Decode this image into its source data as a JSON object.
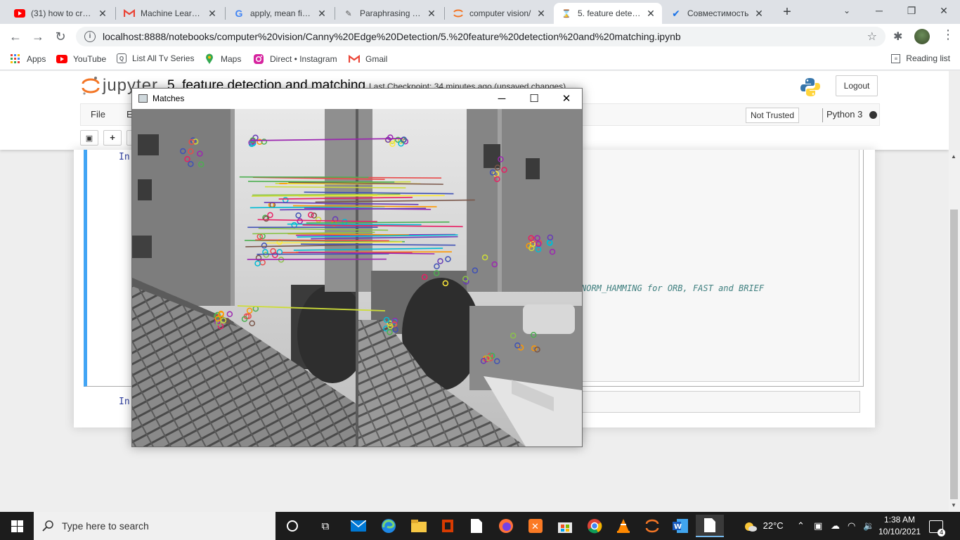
{
  "browser": {
    "tabs": [
      {
        "title": "(31) how to creat",
        "favicon": "youtube-icon",
        "color": "#ff0000"
      },
      {
        "title": "Machine Learning",
        "favicon": "gmail-icon",
        "color": "#ea4335"
      },
      {
        "title": "apply, mean filter",
        "favicon": "google-icon",
        "color": "#4285f4"
      },
      {
        "title": "Paraphrasing Too",
        "favicon": "quill-icon",
        "color": "#555555"
      },
      {
        "title": "computer vision/",
        "favicon": "jupyter-icon",
        "color": "#f37626"
      },
      {
        "title": "5. feature detectio",
        "favicon": "hourglass-icon",
        "color": "#f37626"
      },
      {
        "title": "Совместимость",
        "favicon": "checkmark-icon",
        "color": "#1a73e8"
      }
    ],
    "url": "localhost:8888/notebooks/computer%20vision/Canny%20Edge%20Detection/5.%20feature%20detection%20and%20matching.ipynb",
    "bookmarks": [
      {
        "label": "Apps",
        "icon": "apps-grid-icon"
      },
      {
        "label": "YouTube",
        "icon": "youtube-icon"
      },
      {
        "label": "List All Tv Series",
        "icon": "tv-icon"
      },
      {
        "label": "Maps",
        "icon": "maps-pin-icon"
      },
      {
        "label": "Direct • Instagram",
        "icon": "instagram-icon"
      },
      {
        "label": "Gmail",
        "icon": "gmail-icon"
      }
    ],
    "reading_list": "Reading list"
  },
  "jupyter": {
    "logo_text": "jupyter",
    "notebook_title": "5. feature detection and matching",
    "checkpoint": "Last Checkpoint: 34 minutes ago  (unsaved changes)",
    "logout": "Logout",
    "menu": [
      "File",
      "E"
    ],
    "trusted": "Not Trusted",
    "kernel": "Python 3",
    "toolbar": {
      "save": "💾",
      "add": "+"
    },
    "prompt_in": "In",
    "code_comment": "NORM_HAMMING for ORB, FAST and BRIEF"
  },
  "cv_window": {
    "title": "Matches"
  },
  "taskbar": {
    "search_placeholder": "Type here to search",
    "weather": "22°C",
    "time": "1:38 AM",
    "date": "10/10/2021",
    "notifications": "4"
  }
}
